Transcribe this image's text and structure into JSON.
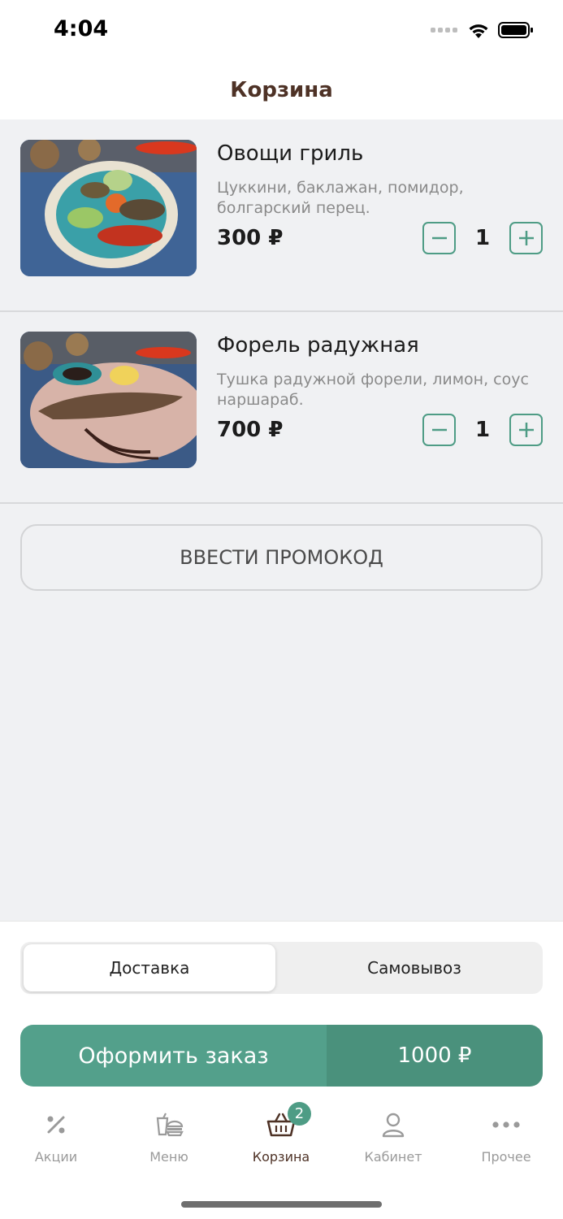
{
  "status_bar": {
    "time": "4:04"
  },
  "header": {
    "title": "Корзина"
  },
  "cart": {
    "items": [
      {
        "name": "Овощи гриль",
        "description": "Цуккини, баклажан, помидор, болгарский перец.",
        "price": "300 ₽",
        "quantity": "1"
      },
      {
        "name": "Форель радужная",
        "description": "Тушка радужной форели, лимон, соус наршараб.",
        "price": "700 ₽",
        "quantity": "1"
      }
    ],
    "promo_label": "ВВЕСТИ ПРОМОКОД"
  },
  "delivery_toggle": {
    "options": [
      "Доставка",
      "Самовывоз"
    ],
    "selected": "Доставка"
  },
  "checkout": {
    "label": "Оформить заказ",
    "total": "1000 ₽"
  },
  "tab_bar": {
    "tabs": [
      {
        "label": "Акции",
        "icon": "percent-icon"
      },
      {
        "label": "Меню",
        "icon": "menu-food-icon"
      },
      {
        "label": "Корзина",
        "icon": "basket-icon",
        "badge": "2"
      },
      {
        "label": "Кабинет",
        "icon": "user-icon"
      },
      {
        "label": "Прочее",
        "icon": "more-icon"
      }
    ],
    "active": "Корзина"
  },
  "colors": {
    "accent": "#4e9c85",
    "brand_brown": "#4e3226",
    "button_dark": "#4a917c"
  }
}
